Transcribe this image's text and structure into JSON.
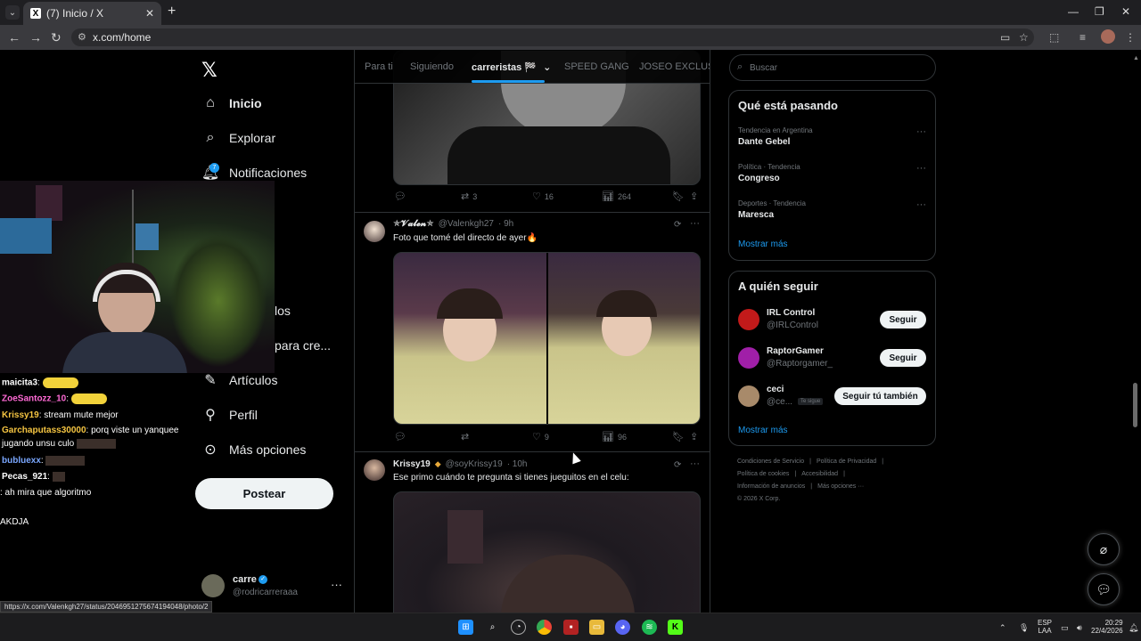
{
  "browser": {
    "tab_title": "(7) Inicio / X",
    "url": "x.com/home",
    "new_tab": "+",
    "tab_close": "✕",
    "status_url": "https://x.com/Valenkgh27/status/2046951275674194048/photo/2"
  },
  "nav": {
    "logo": "𝕏",
    "items": [
      {
        "label": "Inicio",
        "icon": "home-icon"
      },
      {
        "label": "Explorar",
        "icon": "search-icon"
      },
      {
        "label": "Notificaciones",
        "icon": "bell-icon",
        "badge": "7"
      },
      {
        "label": "Artículos",
        "icon": "article-icon"
      },
      {
        "label": "Perfil",
        "icon": "person-icon"
      },
      {
        "label": "Más opciones",
        "icon": "more-circle-icon"
      }
    ],
    "hidden_partial": [
      "n",
      "los",
      "para cre..."
    ],
    "post_button": "Postear",
    "account": {
      "name": "carre",
      "handle": "@rodricarreraaa",
      "more": "···"
    }
  },
  "feed": {
    "tabs": [
      {
        "label": "Para ti"
      },
      {
        "label": "Siguiendo"
      },
      {
        "label": "carreristas 🏁",
        "active": true
      },
      {
        "label": "SPEED GANG"
      },
      {
        "label": "JOSEO EXCLUSIV"
      }
    ],
    "tweets": [
      {
        "actions": {
          "replies": "",
          "retweets": "3",
          "likes": "16",
          "views": "264"
        }
      },
      {
        "name": "✯𝓥𝓪𝓵𝓮𝓷✯",
        "handle": "@Valenkgh27",
        "time": "· 9h",
        "text": "Foto que tomé del directo de ayer🔥",
        "actions": {
          "replies": "",
          "retweets": "",
          "likes": "9",
          "views": "96"
        }
      },
      {
        "name": "Krissy19",
        "handle": "@soyKrissy19",
        "time": "· 10h",
        "text": "Ese primo cuándo te pregunta si tienes jueguitos en el celu:"
      }
    ]
  },
  "sidebar": {
    "search_placeholder": "Buscar",
    "trending_title": "Qué está pasando",
    "trends": [
      {
        "context": "Tendencia en Argentina",
        "name": "Dante Gebel"
      },
      {
        "context": "Política · Tendencia",
        "name": "Congreso"
      },
      {
        "context": "Deportes · Tendencia",
        "name": "Maresca"
      }
    ],
    "trends_more": "Mostrar más",
    "follow_title": "A quién seguir",
    "follow": [
      {
        "name": "IRL Control",
        "handle": "@IRLControl",
        "button": "Seguir",
        "color": "#c21a1a"
      },
      {
        "name": "RaptorGamer",
        "handle": "@Raptorgamer_",
        "button": "Seguir",
        "color": "#a01fa8"
      },
      {
        "name": "ceci",
        "handle": "@ce...",
        "button": "Seguir tú también",
        "badge": "Te sigue",
        "color": "#a88a6a"
      }
    ],
    "follow_more": "Mostrar más",
    "footer": [
      "Condiciones de Servicio",
      "|",
      "Política de Privacidad",
      "|",
      "Política de cookies",
      "|",
      "Accesibilidad",
      "|",
      "Información de anuncios",
      "|",
      "Más opciones ···",
      "© 2026 X Corp."
    ]
  },
  "stream_chat": [
    {
      "user": "maicita3",
      "color": "#ffffff",
      "msg": ":"
    },
    {
      "user": "ZoeSantozz_10",
      "color": "#ff6ad5",
      "msg": ":"
    },
    {
      "user": "Krissy19",
      "color": "#f5c542",
      "msg": ": stream mute mejor"
    },
    {
      "user": "Garchaputass30000",
      "color": "#f5c542",
      "msg": ": porq viste un yanquee"
    },
    {
      "user": "",
      "color": "#ffffff",
      "msg": "jugando unsu culo"
    },
    {
      "user": "bubluexx",
      "color": "#7aa7ff",
      "msg": ":"
    },
    {
      "user": "Pecas_921",
      "color": "#ffffff",
      "msg": ":"
    },
    {
      "user": "",
      "color": "#ffffff",
      "msg": ": ah mira que algoritmo"
    },
    {
      "user": "",
      "color": "#ffffff",
      "msg": "AKDJA"
    }
  ],
  "taskbar": {
    "lang": "ESP",
    "lang2": "LAA",
    "time": "20:29",
    "date": "22/4/2026"
  }
}
